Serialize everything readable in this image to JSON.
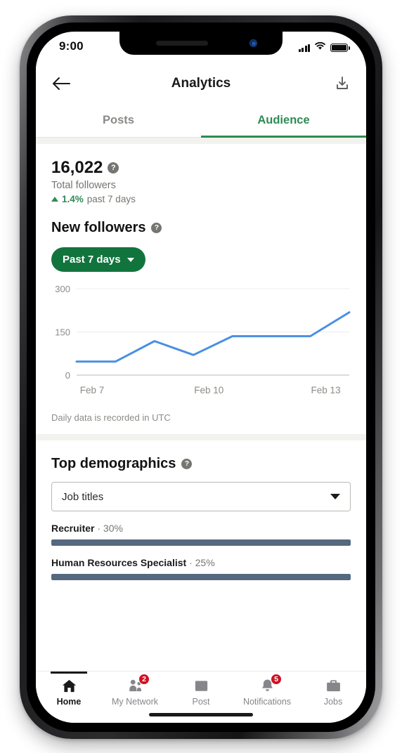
{
  "status_bar": {
    "time": "9:00",
    "signal_icon": "signal-bars-icon",
    "wifi_icon": "wifi-icon",
    "battery_icon": "battery-icon"
  },
  "header": {
    "back_icon": "back-arrow-icon",
    "title": "Analytics",
    "download_icon": "download-icon"
  },
  "tabs": [
    {
      "label": "Posts",
      "active": false
    },
    {
      "label": "Audience",
      "active": true
    }
  ],
  "followers": {
    "count": "16,022",
    "help_icon": "help-circle-icon",
    "subtitle": "Total followers",
    "delta_icon": "triangle-up-icon",
    "delta_value": "1.4%",
    "delta_period": "past 7 days"
  },
  "new_followers": {
    "title": "New followers",
    "help_icon": "help-circle-icon",
    "range_label": "Past 7 days",
    "range_caret_icon": "chevron-down-icon",
    "note": "Daily data is recorded in UTC"
  },
  "demographics": {
    "title": "Top demographics",
    "help_icon": "help-circle-icon",
    "select_value": "Job titles",
    "select_caret_icon": "chevron-down-icon",
    "rows": [
      {
        "name": "Recruiter",
        "sep": " · ",
        "pct": "30%",
        "value": 30
      },
      {
        "name": "Human Resources Specialist",
        "sep": " · ",
        "pct": "25%",
        "value": 25
      }
    ]
  },
  "bottom_nav": [
    {
      "label": "Home",
      "icon": "home-icon",
      "active": true,
      "badge": null
    },
    {
      "label": "My Network",
      "icon": "people-icon",
      "active": false,
      "badge": "2"
    },
    {
      "label": "Post",
      "icon": "plus-square-icon",
      "active": false,
      "badge": null
    },
    {
      "label": "Notifications",
      "icon": "bell-icon",
      "active": false,
      "badge": "5"
    },
    {
      "label": "Jobs",
      "icon": "briefcase-icon",
      "active": false,
      "badge": null
    }
  ],
  "colors": {
    "brand_green": "#12743d",
    "tab_green": "#2f8b54",
    "chart_line": "#4a90e2",
    "bar_slate": "#54687f",
    "badge_red": "#d11124",
    "muted_text": "#757571"
  },
  "chart_data": {
    "type": "line",
    "title": "New followers",
    "xlabel": "",
    "ylabel": "",
    "ylim": [
      0,
      300
    ],
    "yticks": [
      0,
      150,
      300
    ],
    "ytick_labels": [
      "0",
      "150",
      "300"
    ],
    "grid": true,
    "legend": "none",
    "x": [
      "Feb 7",
      "Feb 8",
      "Feb 9",
      "Feb 10",
      "Feb 11",
      "Feb 12",
      "Feb 13",
      "Feb 14"
    ],
    "xtick_labels": [
      "Feb 7",
      "Feb 10",
      "Feb 13"
    ],
    "xtick_indices": [
      0,
      3,
      6
    ],
    "values": [
      47,
      47,
      118,
      70,
      135,
      135,
      135,
      218
    ],
    "series": [
      {
        "name": "New followers",
        "values": [
          47,
          47,
          118,
          70,
          135,
          135,
          135,
          218
        ]
      }
    ],
    "line_color": "#4a90e2"
  }
}
